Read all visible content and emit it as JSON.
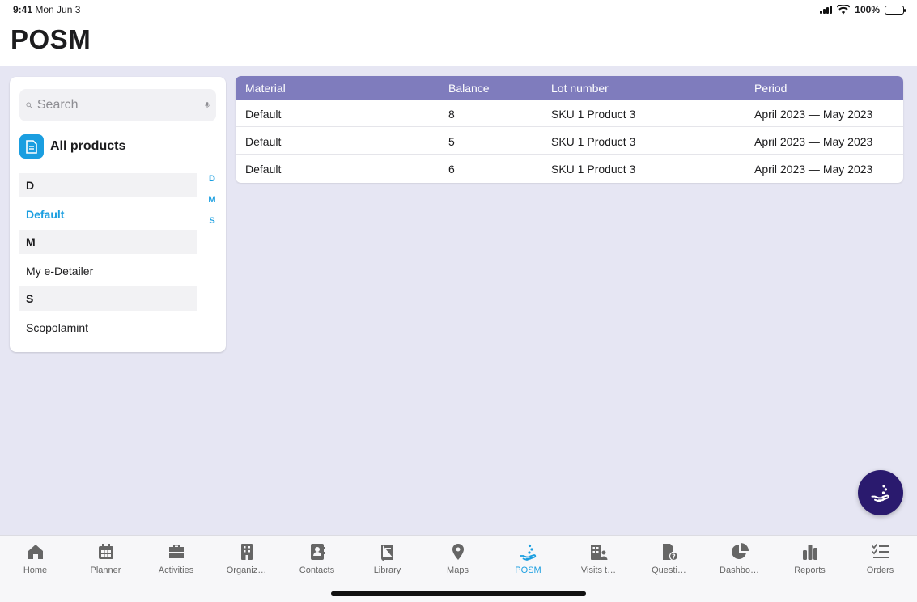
{
  "status": {
    "time": "9:41",
    "date": "Mon Jun 3",
    "battery": "100%",
    "battery_level": 1.0
  },
  "header": {
    "title": "POSM"
  },
  "sidebar": {
    "search_placeholder": "Search",
    "all_products": "All products",
    "groups": [
      {
        "letter": "D",
        "items": [
          "Default"
        ]
      },
      {
        "letter": "M",
        "items": [
          "My e-Detailer"
        ]
      },
      {
        "letter": "S",
        "items": [
          "Scopolamint"
        ]
      }
    ],
    "selected_item": "Default",
    "index_letters": [
      "D",
      "M",
      "S"
    ]
  },
  "table": {
    "columns": [
      "Material",
      "Balance",
      "Lot number",
      "Period"
    ],
    "rows": [
      [
        "Default",
        "8",
        "SKU 1 Product 3",
        "April 2023 — May 2023"
      ],
      [
        "Default",
        "5",
        "SKU 1 Product 3",
        "April 2023 — May 2023"
      ],
      [
        "Default",
        "6",
        "SKU 1 Product 3",
        "April 2023 — May 2023"
      ]
    ]
  },
  "fab": {
    "icon": "hand-drop-icon"
  },
  "tabs": [
    {
      "label": "Home",
      "icon": "home-icon"
    },
    {
      "label": "Planner",
      "icon": "calendar-icon"
    },
    {
      "label": "Activities",
      "icon": "briefcase-icon"
    },
    {
      "label": "Organiz…",
      "icon": "building-icon"
    },
    {
      "label": "Contacts",
      "icon": "contacts-icon"
    },
    {
      "label": "Library",
      "icon": "book-icon"
    },
    {
      "label": "Maps",
      "icon": "map-pin-icon"
    },
    {
      "label": "POSM",
      "icon": "hand-drop-icon",
      "active": true
    },
    {
      "label": "Visits t…",
      "icon": "building-people-icon"
    },
    {
      "label": "Questi…",
      "icon": "question-doc-icon"
    },
    {
      "label": "Dashbo…",
      "icon": "pie-chart-icon"
    },
    {
      "label": "Reports",
      "icon": "bar-chart-icon"
    },
    {
      "label": "Orders",
      "icon": "checklist-icon"
    }
  ],
  "colors": {
    "accent": "#1a9ee0",
    "table_header": "#7f7cbd",
    "fab": "#2a1a6e",
    "background": "#e6e6f3"
  }
}
